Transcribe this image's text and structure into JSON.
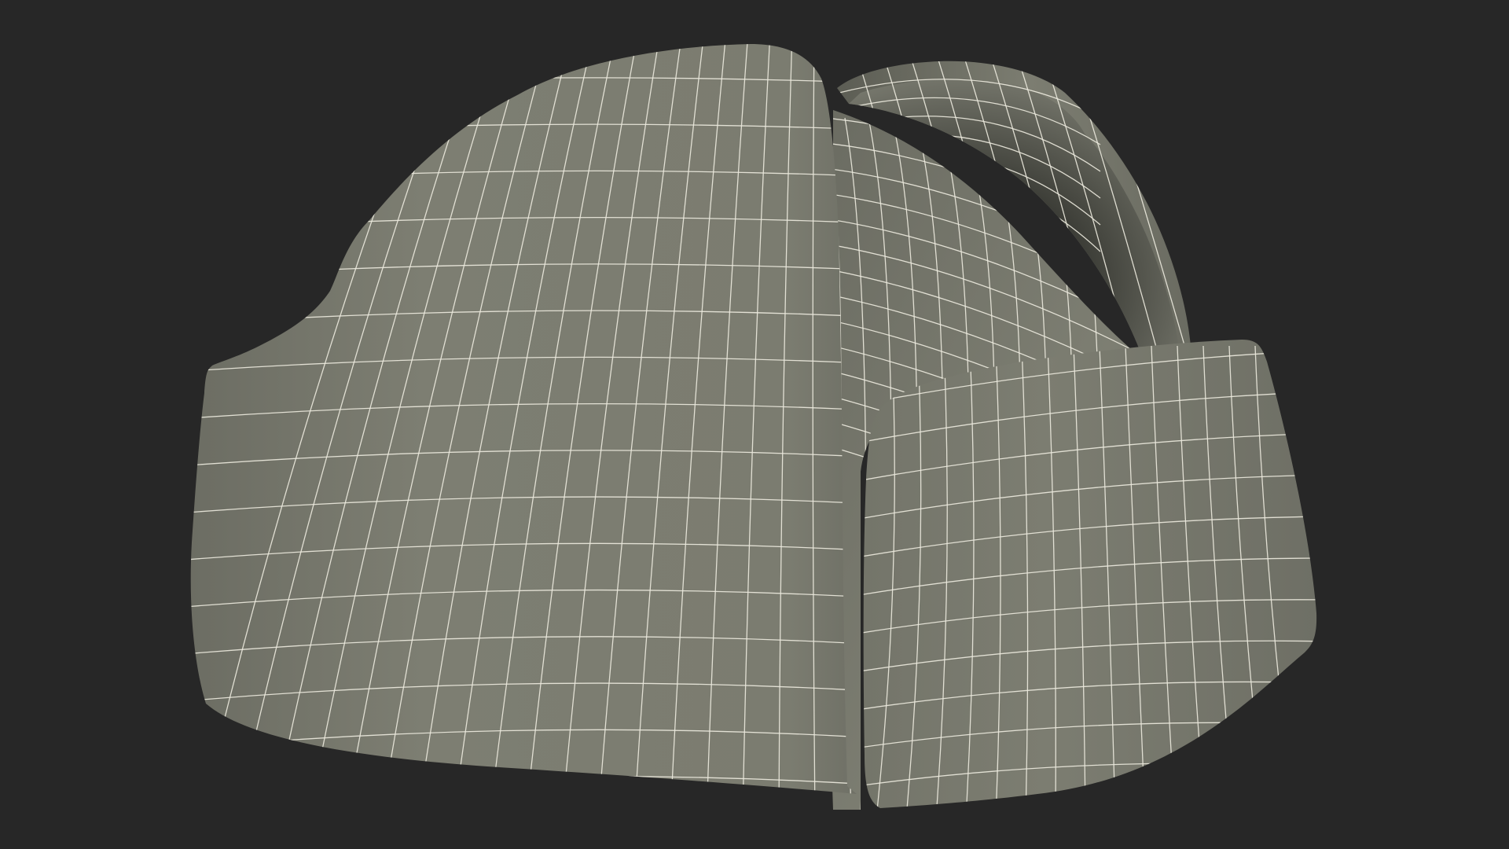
{
  "viewport": {
    "background_color": "#272727"
  },
  "model": {
    "subject": "ushanka-fur-hat-wireframe",
    "surface_color": "#7b7c70",
    "surface_shadow_color": "#4a4b43",
    "surface_highlight_color": "#8a8b7e",
    "wire_color": "#eae8dc"
  }
}
